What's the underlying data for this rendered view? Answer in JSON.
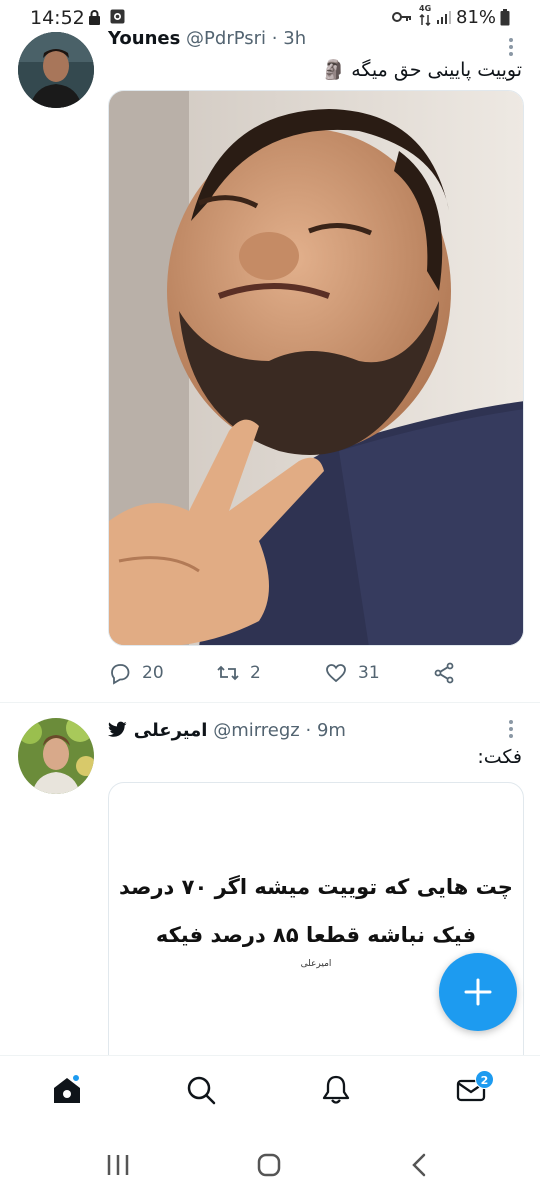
{
  "status_bar": {
    "time": "14:52",
    "network": "4G",
    "battery": "81%"
  },
  "tweets": [
    {
      "display_name": "Younes",
      "handle": "@PdrPsri",
      "separator": "·",
      "time": "3h",
      "text": "توییت پایینی حق میگه",
      "emoji": "🗿",
      "replies": "20",
      "retweets": "2",
      "likes": "31"
    },
    {
      "display_name": "امیرعلی",
      "handle": "@mirregz",
      "separator": "·",
      "time": "9m",
      "text": "فکت:",
      "card_lines": [
        "چت هایی که توییت میشه اگر ۷۰ درصد",
        "فیک نباشه قطعا ۸۵ درصد فیکه"
      ],
      "card_signature": "امیرعلی"
    }
  ],
  "bottom_nav": {
    "messages_badge": "2",
    "items": [
      "home-icon",
      "search-icon",
      "notifications-icon",
      "messages-icon"
    ]
  },
  "colors": {
    "accent": "#1d9bf0",
    "secondary_text": "#536471"
  }
}
